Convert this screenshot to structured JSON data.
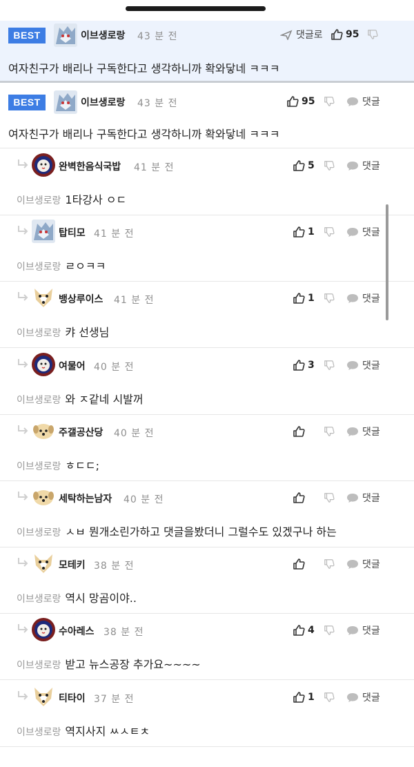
{
  "best_label": "BEST",
  "reply_label": "댓글",
  "reply_to": "이브생로랑",
  "pinned": {
    "nickname": "이브생로랑",
    "time": "43 분 전",
    "reply": "댓글로",
    "likes": "95",
    "text": "여자친구가 배리나 구독한다고 생각하니까 확와닿네 ㅋㅋㅋ"
  },
  "best": {
    "nickname": "이브생로랑",
    "time": "43 분 전",
    "likes": "95",
    "text": "여자친구가 배리나 구독한다고 생각하니까 확와닿네 ㅋㅋㅋ"
  },
  "replies": [
    {
      "nickname": "완벽한음식국밥",
      "time": "41 분 전",
      "likes": "5",
      "text": "1타강사 ㅇㄷ",
      "avatar": "lion"
    },
    {
      "nickname": "탑티모",
      "time": "41 분 전",
      "likes": "1",
      "text": "ㄹㅇㅋㅋ",
      "avatar": "wolf"
    },
    {
      "nickname": "뱅상루이스",
      "time": "41 분 전",
      "likes": "1",
      "text": "캬 선생님",
      "avatar": "dog"
    },
    {
      "nickname": "여물어",
      "time": "40 분 전",
      "likes": "3",
      "text": "와 ㅈ같네 시발꺼",
      "avatar": "lion"
    },
    {
      "nickname": "주갤공산당",
      "time": "40 분 전",
      "likes": "",
      "text": "ㅎㄷㄷ;",
      "avatar": "pup"
    },
    {
      "nickname": "세탁하는남자",
      "time": "40 분 전",
      "likes": "",
      "text": "ㅅㅂ 뭔개소린가하고 댓글을봤더니 그럴수도 있겠구나 하는",
      "avatar": "pup"
    },
    {
      "nickname": "모테키",
      "time": "38 분 전",
      "likes": "",
      "text": "역시 망곰이야..",
      "avatar": "dog"
    },
    {
      "nickname": "수아레스",
      "time": "38 분 전",
      "likes": "4",
      "text": "받고 뉴스공장 추가요~~~~",
      "avatar": "lion"
    },
    {
      "nickname": "티타이",
      "time": "37 분 전",
      "likes": "1",
      "text": "역지사지 ㅆㅅㅌㅊ",
      "avatar": "dog"
    }
  ],
  "colors": {
    "best_badge": "#3d7de4",
    "pinned_bg": "#edf3fd",
    "muted": "#8e8e8e"
  }
}
